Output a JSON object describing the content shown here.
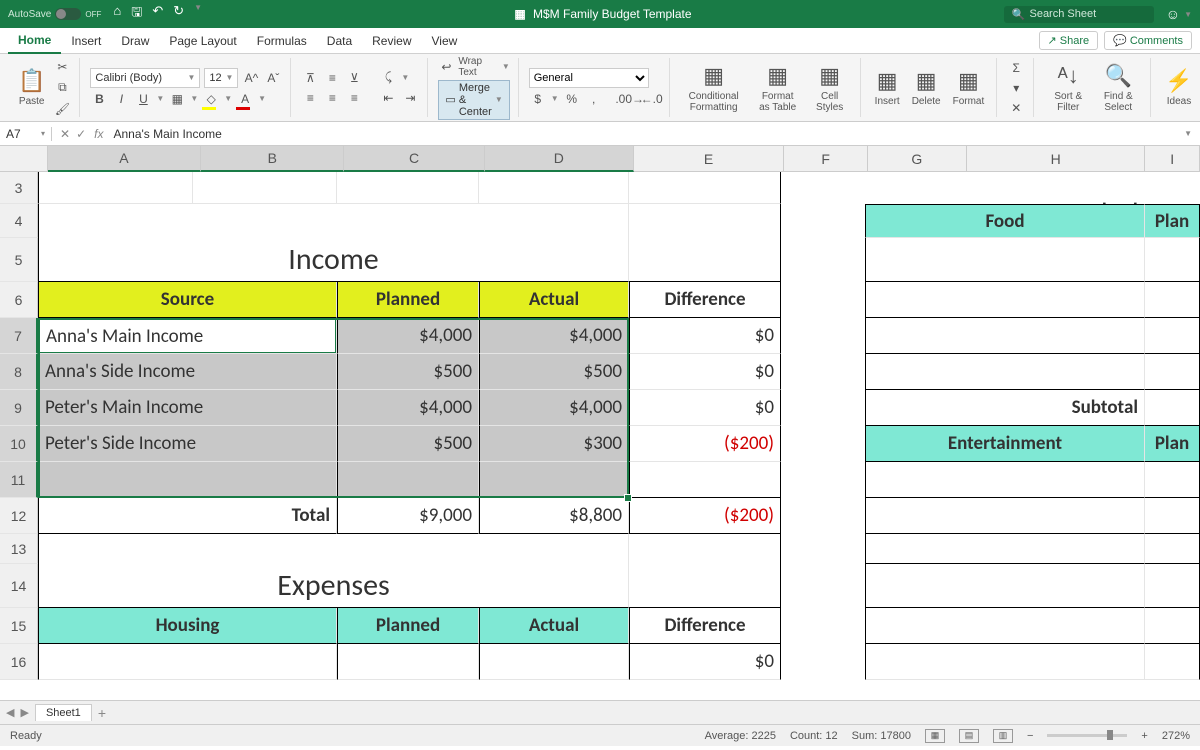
{
  "titlebar": {
    "autosave": "AutoSave",
    "autosave_state": "OFF",
    "title": "M$M Family Budget Template",
    "search_placeholder": "Search Sheet"
  },
  "tabs": {
    "items": [
      "Home",
      "Insert",
      "Draw",
      "Page Layout",
      "Formulas",
      "Data",
      "Review",
      "View"
    ],
    "active": 0,
    "share": "Share",
    "comments": "Comments"
  },
  "ribbon": {
    "paste": "Paste",
    "font_name": "Calibri (Body)",
    "font_size": "12",
    "bold": "B",
    "italic": "I",
    "underline": "U",
    "wrap": "Wrap Text",
    "merge": "Merge & Center",
    "number_format": "General",
    "cond_fmt": "Conditional Formatting",
    "fmt_table": "Format as Table",
    "cell_styles": "Cell Styles",
    "insert": "Insert",
    "delete": "Delete",
    "format": "Format",
    "sort": "Sort & Filter",
    "find": "Find & Select",
    "ideas": "Ideas"
  },
  "formula_bar": {
    "cell": "A7",
    "value": "Anna's Main Income"
  },
  "columns": [
    "A",
    "B",
    "C",
    "D",
    "E",
    "F",
    "G",
    "H",
    "I"
  ],
  "row_numbers": [
    3,
    4,
    5,
    6,
    7,
    8,
    9,
    10,
    11,
    12,
    13,
    14,
    15,
    16
  ],
  "sheet": {
    "income_title": "Income",
    "expenses_title": "Expenses",
    "headers": {
      "source": "Source",
      "planned": "Planned",
      "actual": "Actual",
      "diff": "Difference"
    },
    "income": [
      {
        "source": "Anna's Main Income",
        "planned": "$4,000",
        "actual": "$4,000",
        "diff": "$0",
        "neg": false
      },
      {
        "source": "Anna's Side Income",
        "planned": "$500",
        "actual": "$500",
        "diff": "$0",
        "neg": false
      },
      {
        "source": "Peter's Main Income",
        "planned": "$4,000",
        "actual": "$4,000",
        "diff": "$0",
        "neg": false
      },
      {
        "source": "Peter's Side Income",
        "planned": "$500",
        "actual": "$300",
        "diff": "($200)",
        "neg": true
      }
    ],
    "total_label": "Total",
    "total": {
      "planned": "$9,000",
      "actual": "$8,800",
      "diff": "($200)"
    },
    "housing": "Housing",
    "row16_diff": "$0",
    "side": {
      "food": "Food",
      "plan": "Plan",
      "subtotal": "Subtotal",
      "entertainment": "Entertainment"
    }
  },
  "sheettab": "Sheet1",
  "status": {
    "ready": "Ready",
    "average": "Average: 2225",
    "count": "Count: 12",
    "sum": "Sum: 17800",
    "zoom": "272%"
  }
}
